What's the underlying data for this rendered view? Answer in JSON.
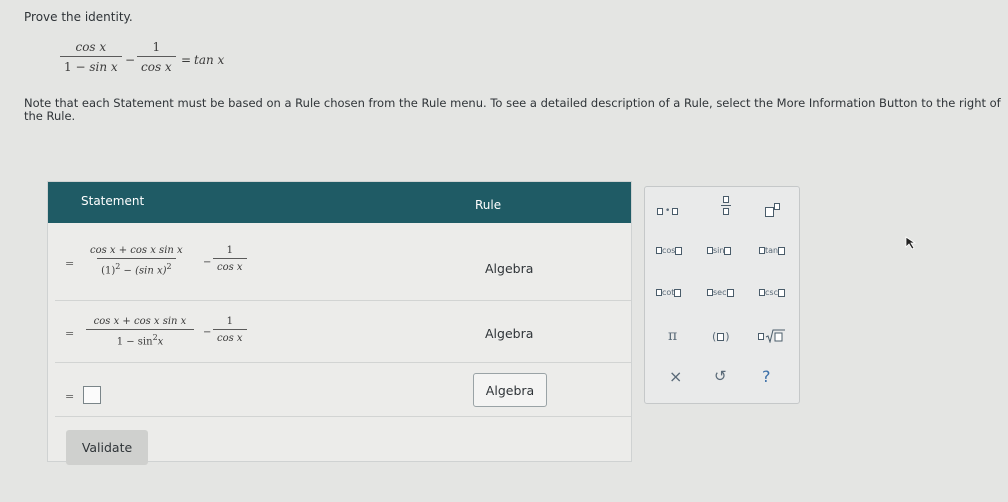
{
  "prompt": "Prove the identity.",
  "identity": {
    "lhs_num1": "cos x",
    "lhs_den1_a": "1",
    "lhs_minus_inner": "−",
    "lhs_den1_b": "sin x",
    "minus": "−",
    "lhs_num2": "1",
    "lhs_den2": "cos x",
    "equals": "=",
    "rhs": "tan x"
  },
  "note": "Note that each Statement must be based on a Rule chosen from the Rule menu. To see a detailed description of a Rule, select the More Information Button to the right of the Rule.",
  "table": {
    "header_statement": "Statement",
    "header_rule": "Rule",
    "rows": [
      {
        "eq": "=",
        "num": "cos x + cos x sin x",
        "den_a": "(1)",
        "den_a_exp": "2",
        "den_minus": "−",
        "den_b": "(sin x)",
        "den_b_exp": "2",
        "minus": "−",
        "frac2_num": "1",
        "frac2_den": "cos x",
        "rule": "Algebra"
      },
      {
        "eq": "=",
        "num": "cos x + cos x sin x",
        "den": "1 − sin",
        "den_exp": "2",
        "den_var": "x",
        "minus": "−",
        "frac2_num": "1",
        "frac2_den": "cos x",
        "rule": "Algebra"
      },
      {
        "eq": "=",
        "rule": "Algebra"
      }
    ],
    "validate_label": "Validate"
  },
  "palette": {
    "cos": "cos",
    "sin": "sin",
    "tan": "tan",
    "cot": "cot",
    "sec": "sec",
    "csc": "csc",
    "pi": "π",
    "paren_open": "(",
    "paren_close": ")",
    "clear": "×",
    "undo": "↺",
    "help": "?"
  }
}
